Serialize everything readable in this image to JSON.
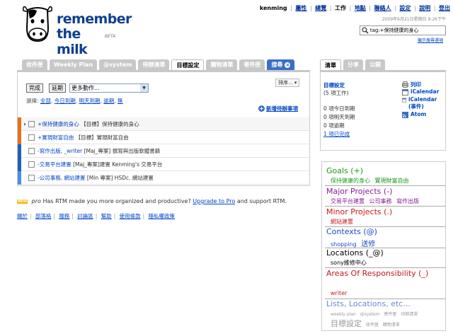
{
  "logo": {
    "line1": "remember",
    "line2": "the milk",
    "beta": "BETA"
  },
  "topnav": {
    "user": "kenming",
    "links": [
      "屬性",
      "總覽",
      "工作",
      "地點",
      "聯絡人",
      "設定",
      "說明",
      "登出"
    ],
    "datetime": "2009年6月21日星期日 9:26下午"
  },
  "search": {
    "value": "tag:+保持健康的身心",
    "tips": "顯示搜尋選項"
  },
  "tabs": [
    {
      "label": "收件匣",
      "active": false
    },
    {
      "label": "Weekly Plan",
      "active": false
    },
    {
      "label": "@system",
      "active": false
    },
    {
      "label": "待辦清單",
      "active": false
    },
    {
      "label": "目標設定",
      "active": true
    },
    {
      "label": "購物清單",
      "active": false
    },
    {
      "label": "寄件匣",
      "active": false
    },
    {
      "label": "搜尋",
      "active": false
    }
  ],
  "toolbar": {
    "complete": "完成",
    "postpone": "延期",
    "more_actions": "更多動作...",
    "sort": "排序...",
    "select_label": "選擇:",
    "select_links": [
      "全部",
      "今日到期",
      "明天到期",
      "逾期",
      "無"
    ],
    "add_task": "新增待辦事項"
  },
  "tasks": [
    {
      "tag": "+保持健康的身心",
      "text": "【目標】保持健康的身心",
      "color": "#e86f1e",
      "selected": true
    },
    {
      "tag": "+實現財富自由",
      "text": "【目標】實現財富自由",
      "color": "#e86f1e",
      "selected": false
    },
    {
      "tag": "-寫作出版, _writer",
      "text": "[Maj_專案] 撰寫與出版軟體書籍",
      "color": "#1f5fbf",
      "selected": false
    },
    {
      "tag": "-交易平台建置",
      "text": "[Maj_專案]建置 Kenming's 交易平台",
      "color": "#1f5fbf",
      "selected": false
    },
    {
      "tag": "-公司事務, 網站建置",
      "text": "[Min 專案] HSDc. 網站建置",
      "color": "#4d8fe0",
      "selected": false
    }
  ],
  "upgrade": {
    "new_badge": "NEW",
    "pro": "pro",
    "text_before": "Has RTM made you more organized and productive?",
    "link": "Upgrade to Pro",
    "text_after": "and support RTM."
  },
  "footer_links": [
    "關於",
    "部落格",
    "服務",
    "討論區",
    "幫助",
    "使用條款",
    "隱私權政策"
  ],
  "right_tabs": [
    {
      "label": "清單",
      "active": true
    },
    {
      "label": "分享",
      "active": false
    },
    {
      "label": "公開",
      "active": false
    }
  ],
  "list_info": {
    "title": "目標設定",
    "count": "(5 項工作)",
    "due_today": "0 項今日到期",
    "due_tomorrow": "0 項明天到期",
    "overdue": "0 項逾期",
    "completed": "1 項已完成"
  },
  "feeds": {
    "print": "列印",
    "ical": "iCalendar",
    "ical_events": "iCalendar (事件)",
    "atom": "Atom"
  },
  "tagcloud": {
    "goals": {
      "heading": "Goals (+)",
      "items": [
        "保持健康的身心",
        "實現財富自由"
      ]
    },
    "major": {
      "heading": "Major Projects (-)",
      "items": [
        "交易平台建置",
        "公司事務",
        "寫作出版"
      ]
    },
    "minor": {
      "heading": "Minor Projects (.)",
      "items": [
        "網站建置"
      ]
    },
    "contexts": {
      "heading": "Contexts (@)",
      "items": [
        "shopping",
        "送修"
      ]
    },
    "locations": {
      "heading": "Locations (_@)",
      "items": [
        "sony維修中心"
      ]
    },
    "areas": {
      "heading": "Areas Of Responsibility (_)",
      "items": [
        "writer"
      ]
    },
    "lists": {
      "heading": "Lists, Locations, etc...",
      "items": [
        "weekly plan",
        "@system",
        "寄件匣",
        "待辦清單",
        "目標設定",
        "收件匣",
        "購物清單"
      ]
    },
    "colors": {
      "goals": "#1a9a1a",
      "major": "#8a1a9a",
      "minor": "#c81a1a",
      "contexts": "#1a4ac8",
      "locations": "#000000",
      "areas": "#c81a1a",
      "lists": "#6a8ad0"
    }
  }
}
